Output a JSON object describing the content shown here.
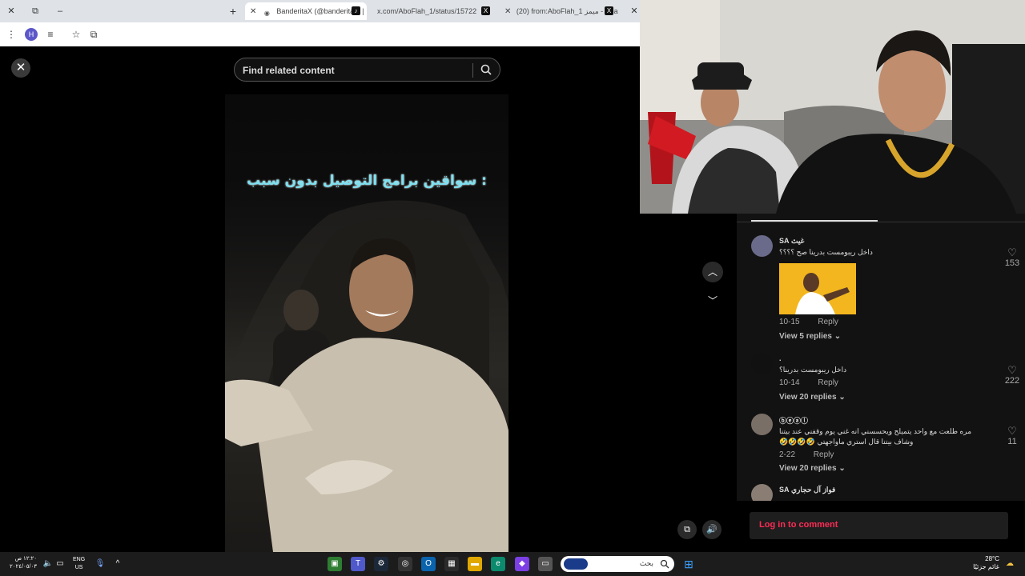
{
  "browser": {
    "tabs": [
      {
        "title": "BanderitaX (@banderitax) |",
        "active": true
      },
      {
        "title": "x.com/AboFlah_1/status/15722",
        "active": false
      },
      {
        "title": "(20) from:AboFlah_1 ميمز - Sea",
        "active": false
      }
    ],
    "new_tab": "+",
    "profile_initial": "H"
  },
  "search": {
    "placeholder": "Find related content"
  },
  "video": {
    "caption": "سواقين برامج التوصيل بدون سبب :"
  },
  "comments": [
    {
      "name": "غيث SA",
      "text": "داخل ريبومست بدرينا صح ؟؟؟؟",
      "date": "10-15",
      "reply": "Reply",
      "view_replies": "View 5 replies",
      "likes": "153"
    },
    {
      "name": ".",
      "text": "داخل ريبومست بدرينا؟",
      "date": "10-14",
      "reply": "Reply",
      "view_replies": "View 20 replies",
      "likes": "222"
    },
    {
      "name": "ⓑⓔⓐⓛ",
      "text": "مره طلعت مع واحد يتميلح ويحسسني انه غني يوم وقفني عند بيتنا وشاف بيتنا قال استري ماواجهتي 🤣🤣🤣🤣",
      "date": "2-22",
      "reply": "Reply",
      "view_replies": "View 20 replies",
      "likes": "11"
    },
    {
      "name": "فواز آل حجاري SA",
      "text": "",
      "date": "",
      "reply": "",
      "view_replies": "",
      "likes": ""
    }
  ],
  "login": {
    "text": "Log in to comment"
  },
  "taskbar": {
    "search_placeholder": "بحث",
    "time": "١٢:٢٠ ص",
    "date": "٢٠٢٤/٠٥/٠٣",
    "lang_top": "ENG",
    "lang_bottom": "US",
    "weather_temp": "28°C",
    "weather_desc": "غائم جزئيًا"
  },
  "colors": {
    "accent": "#fe2c55",
    "caption": "#7de0f0"
  }
}
